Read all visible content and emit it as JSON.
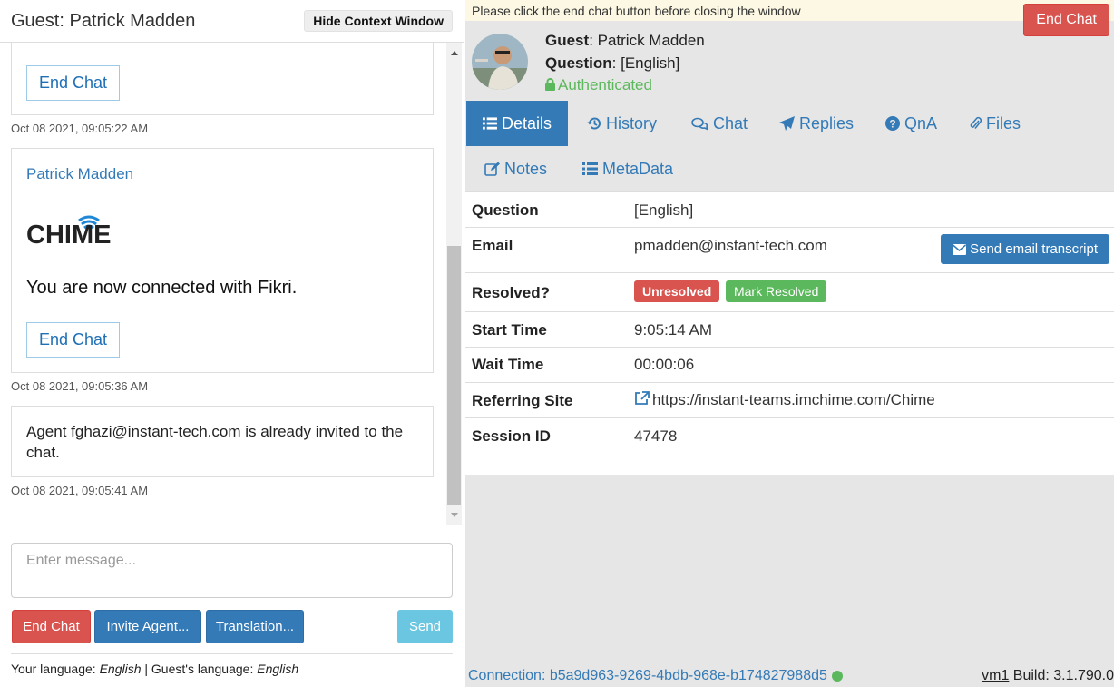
{
  "left": {
    "title": "Guest: Patrick Madden",
    "hide_context_label": "Hide Context Window",
    "messages": [
      {
        "end_chat_label": "End Chat",
        "timestamp": "Oct 08 2021, 09:05:22 AM"
      },
      {
        "sender": "Patrick Madden",
        "logo_text": "CHIME",
        "text": "You are now connected with Fikri.",
        "end_chat_label": "End Chat",
        "timestamp": "Oct 08 2021, 09:05:36 AM"
      },
      {
        "text": "Agent fghazi@instant-tech.com is already invited to the chat.",
        "timestamp": "Oct 08 2021, 09:05:41 AM"
      }
    ],
    "compose": {
      "placeholder": "Enter message...",
      "end_chat_label": "End Chat",
      "invite_label": "Invite Agent...",
      "translation_label": "Translation...",
      "send_label": "Send"
    },
    "language": {
      "your_label": "Your language:",
      "your_value": "English",
      "separator": "|",
      "guest_label": "Guest's language:",
      "guest_value": "English"
    }
  },
  "right": {
    "warning": "Please click the end chat button before closing the window",
    "end_chat_label": "End Chat",
    "guest": {
      "guest_label": "Guest",
      "guest_value": ": Patrick Madden",
      "question_label": "Question",
      "question_value": ": [English]",
      "auth_label": "Authenticated"
    },
    "tabs": [
      {
        "label": "Details",
        "icon": "list-icon",
        "active": true
      },
      {
        "label": "History",
        "icon": "history-icon"
      },
      {
        "label": "Chat",
        "icon": "comments-icon"
      },
      {
        "label": "Replies",
        "icon": "send-icon"
      },
      {
        "label": "QnA",
        "icon": "question-circle-icon"
      },
      {
        "label": "Files",
        "icon": "paperclip-icon"
      },
      {
        "label": "Notes",
        "icon": "edit-icon"
      },
      {
        "label": "MetaData",
        "icon": "list-icon"
      }
    ],
    "details": {
      "question": {
        "label": "Question",
        "value": "[English]"
      },
      "email": {
        "label": "Email",
        "value": "pmadden@instant-tech.com",
        "button": "Send email transcript"
      },
      "resolved": {
        "label": "Resolved?",
        "status": "Unresolved",
        "button": "Mark Resolved"
      },
      "start_time": {
        "label": "Start Time",
        "value": "9:05:14 AM"
      },
      "wait_time": {
        "label": "Wait Time",
        "value": "00:00:06"
      },
      "referring_site": {
        "label": "Referring Site",
        "value": "https://instant-teams.imchime.com/Chime"
      },
      "session_id": {
        "label": "Session ID",
        "value": "47478"
      }
    },
    "footer": {
      "connection": "Connection: b5a9d963-9269-4bdb-968e-b174827988d5",
      "vm": "vm1",
      "build": "Build: 3.1.790.0"
    }
  },
  "colors": {
    "primary": "#337ab7",
    "danger": "#d9534f",
    "success": "#5cb85c",
    "info": "#5bc0de",
    "warning_bg": "#fcf8e3"
  }
}
